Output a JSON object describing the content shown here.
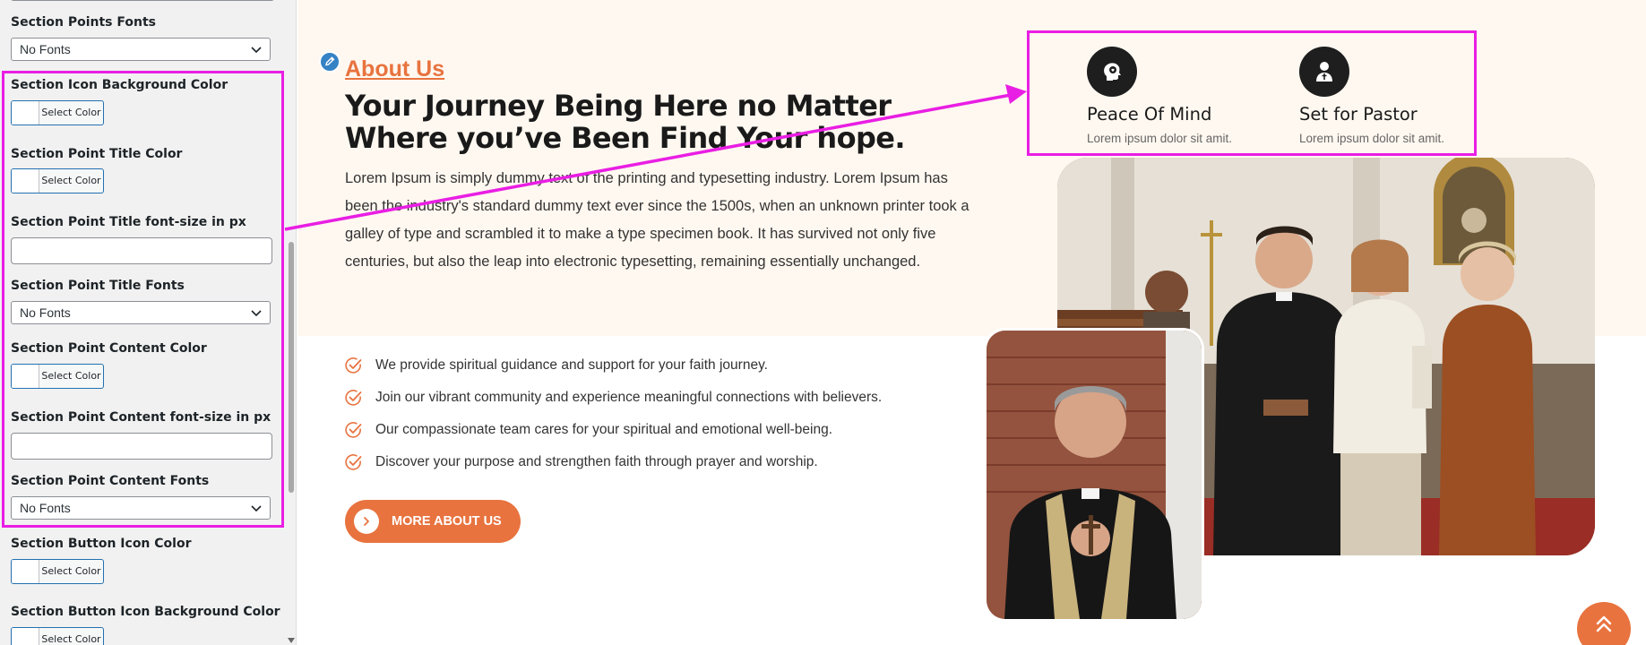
{
  "sidebar": {
    "controls": [
      {
        "label": "Section Points Fonts",
        "type": "select",
        "value": "No Fonts"
      },
      {
        "label": "Section Icon Background Color",
        "type": "color",
        "button_label": "Select Color"
      },
      {
        "label": "Section Point Title Color",
        "type": "color",
        "button_label": "Select Color"
      },
      {
        "label": "Section Point Title font-size in px",
        "type": "text",
        "value": ""
      },
      {
        "label": "Section Point Title Fonts",
        "type": "select",
        "value": "No Fonts"
      },
      {
        "label": "Section Point Content Color",
        "type": "color",
        "button_label": "Select Color"
      },
      {
        "label": "Section Point Content font-size in px",
        "type": "text",
        "value": ""
      },
      {
        "label": "Section Point Content Fonts",
        "type": "select",
        "value": "No Fonts"
      },
      {
        "label": "Section Button Icon Color",
        "type": "color",
        "button_label": "Select Color"
      },
      {
        "label": "Section Button Icon Background Color",
        "type": "color",
        "button_label": "Select Color"
      }
    ]
  },
  "preview": {
    "about_label": "About Us",
    "heading": "Your Journey Being Here no Matter Where you’ve Been Find Your hope.",
    "paragraph": "Lorem Ipsum is simply dummy text of the printing and typesetting industry. Lorem Ipsum has been the industry's standard dummy text ever since the 1500s, when an unknown printer took a galley of type and scrambled it to make a type specimen book. It has survived not only five centuries, but also the leap into electronic typesetting, remaining essentially unchanged.",
    "points": [
      "We provide spiritual guidance and support for your faith journey.",
      "Join our vibrant community and experience meaningful connections with believers.",
      "Our compassionate team cares for your spiritual and emotional well-being.",
      "Discover your purpose and strengthen faith through prayer and worship."
    ],
    "button_label": "MORE ABOUT US",
    "features": [
      {
        "icon": "peace-of-mind-icon",
        "title": "Peace Of Mind",
        "text": "Lorem ipsum dolor sit amit."
      },
      {
        "icon": "pastor-icon",
        "title": "Set for Pastor",
        "text": "Lorem ipsum dolor sit amit."
      }
    ]
  },
  "colors": {
    "accent": "#e8733f",
    "highlight": "#e91ee4",
    "cream_background": "#fff8f0",
    "icon_background": "#1e1e1e",
    "sidebar_background": "#f1f1f1"
  }
}
